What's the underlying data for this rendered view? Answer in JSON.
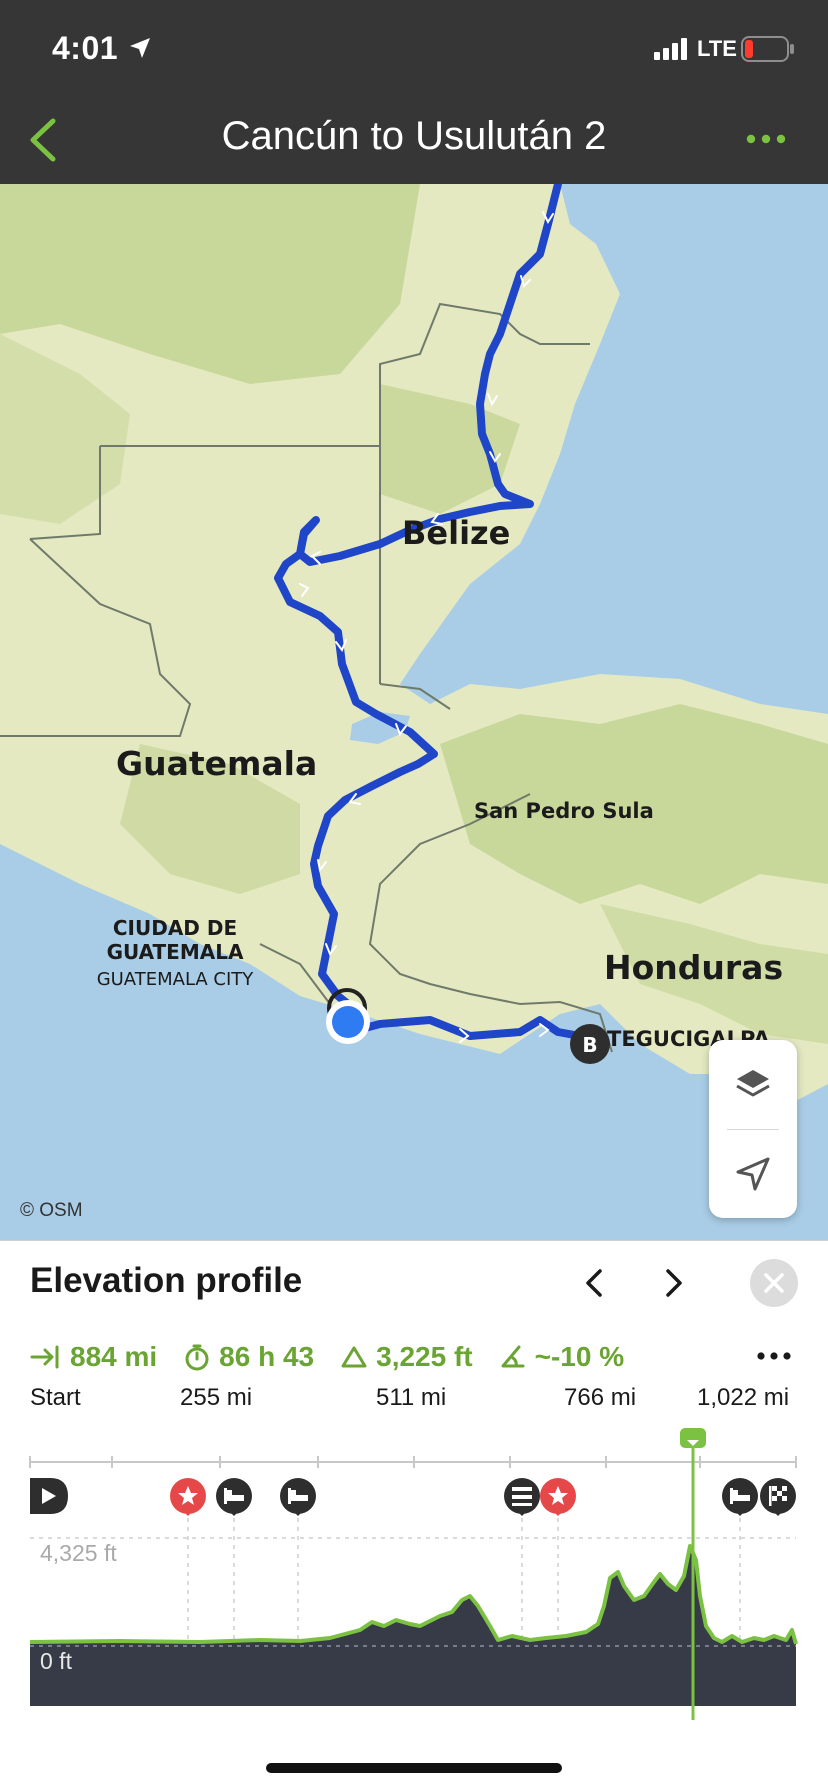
{
  "status_bar": {
    "time": "4:01",
    "network": "LTE",
    "battery_level": 0.12,
    "icons": [
      "location-arrow-icon",
      "signal-bars-icon",
      "battery-low-icon"
    ]
  },
  "nav": {
    "title": "Cancún to Usulután 2",
    "back_icon": "chevron-left-icon",
    "more_icon": "ellipsis-icon",
    "accent_color": "#7cc242"
  },
  "map": {
    "labels": {
      "belize": "Belize",
      "guatemala": "Guatemala",
      "san_pedro_sula": "San Pedro Sula",
      "ciudad_de_guatemala": "CIUDAD DE\nGUATEMALA",
      "guatemala_city": "GUATEMALA CITY",
      "honduras": "Honduras",
      "tegucigalpa": "TEGUCIGALPA"
    },
    "attribution": "© OSM",
    "end_marker": "B",
    "route_color": "#1f45c8",
    "controls": [
      "layers-icon",
      "locate-arrow-icon"
    ]
  },
  "elevation": {
    "title": "Elevation profile",
    "stats": {
      "distance": "884 mi",
      "duration": "86 h 43",
      "ascent": "3,225 ft",
      "grade": "~-10 %"
    },
    "x_ticks": [
      "Start",
      "255 mi",
      "511 mi",
      "766 mi",
      "1,022 mi"
    ],
    "y_max": "4,325 ft",
    "y_min": "0 ft",
    "profile_color": "#7cc242",
    "waypoint_icons": [
      "start-play-icon",
      "favorite-star-icon",
      "bed-icon",
      "bed-icon",
      "hotel-icon",
      "favorite-star-icon",
      "bed-icon",
      "finish-flag-icon"
    ]
  }
}
